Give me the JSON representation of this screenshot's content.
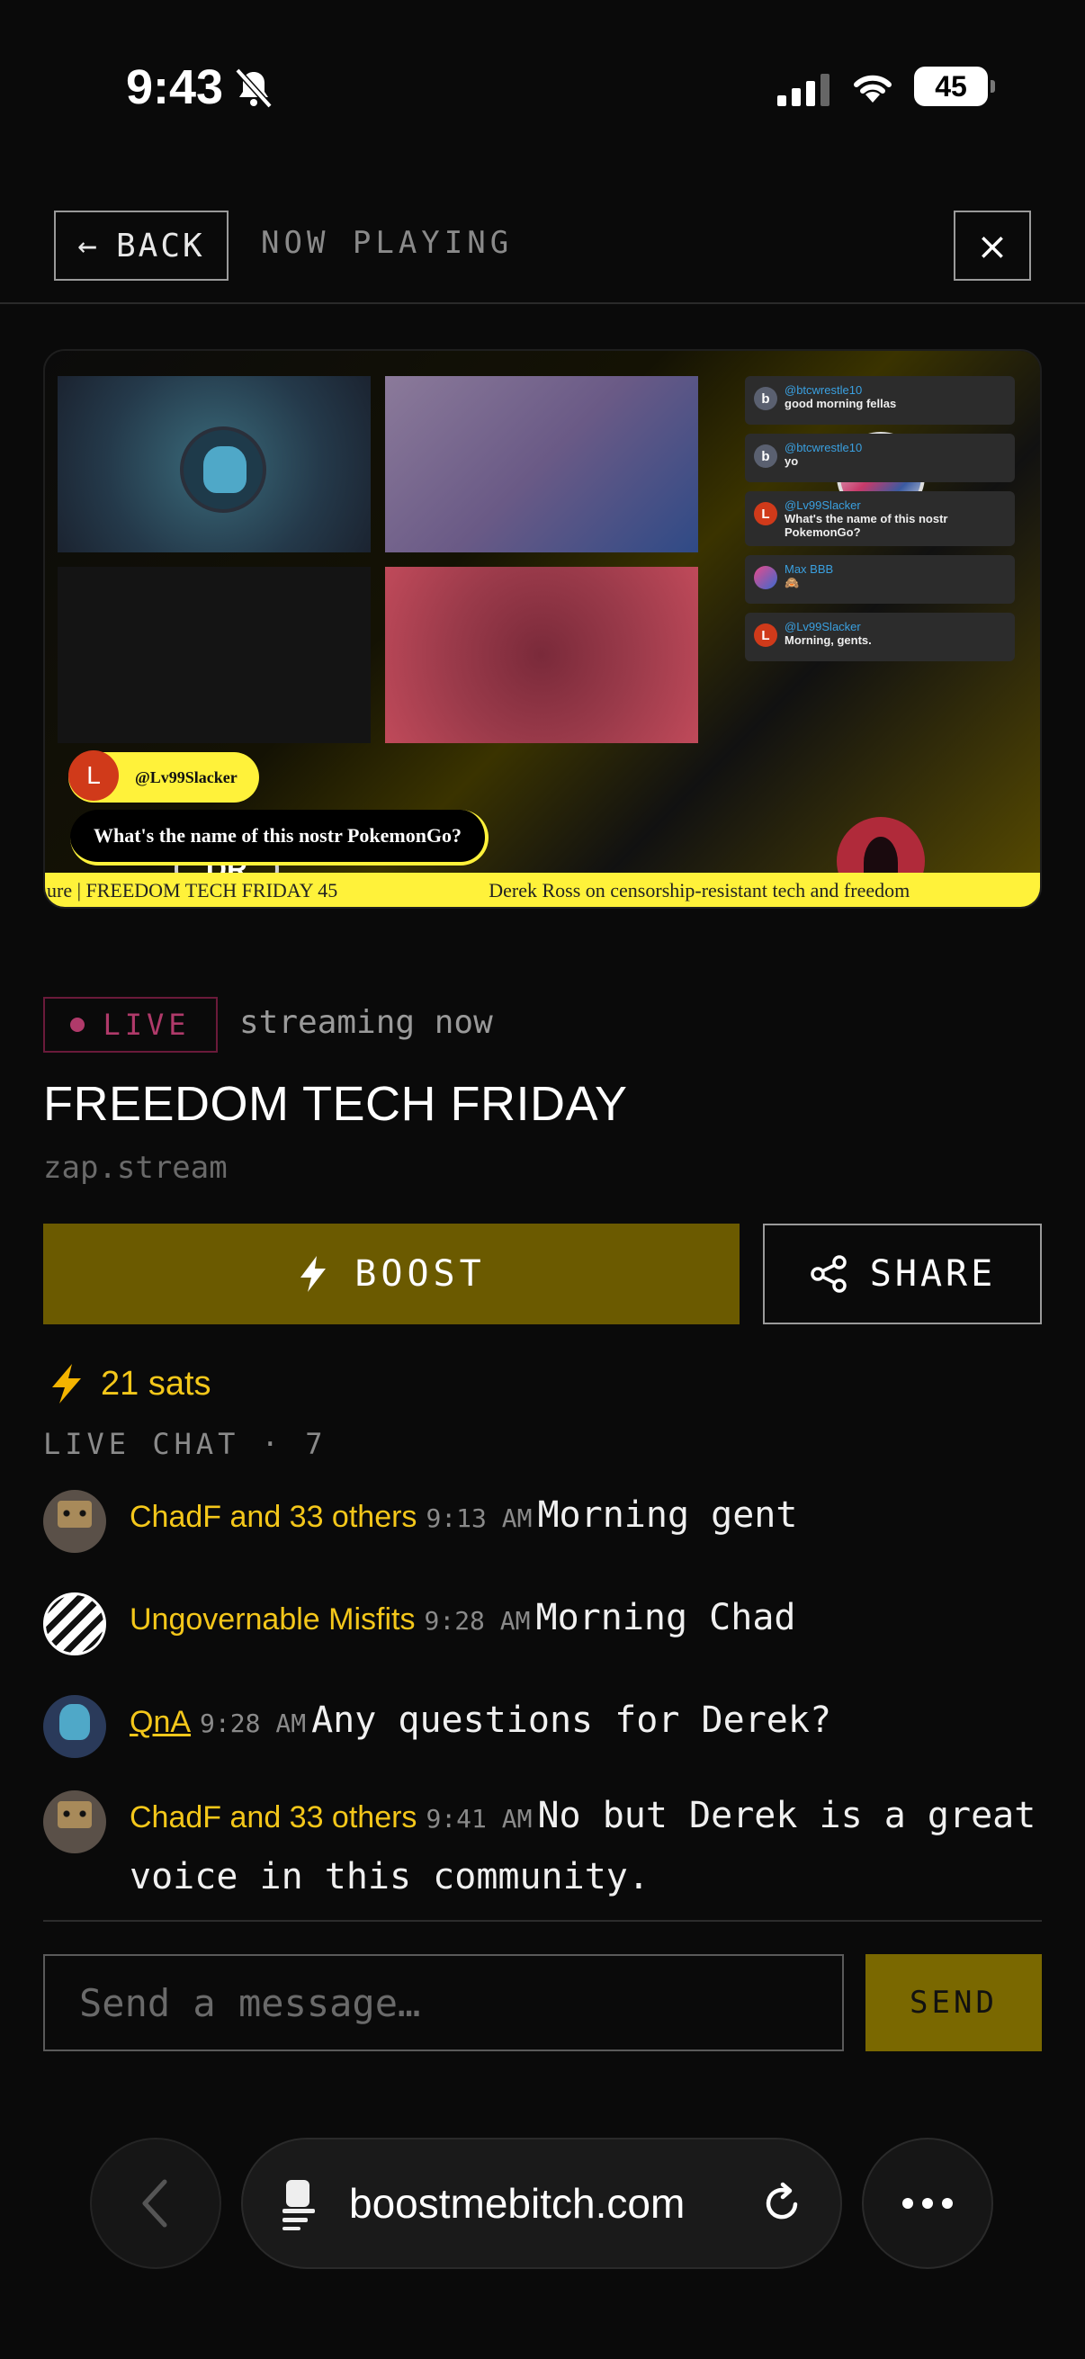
{
  "status_bar": {
    "time": "9:43",
    "battery": "45"
  },
  "header": {
    "back_label": "BACK",
    "now_playing": "NOW PLAYING",
    "close_label": "×"
  },
  "video": {
    "host_initials": "DR",
    "side_chat": [
      {
        "initial": "b",
        "user": "@btcwrestle10",
        "message": "good morning fellas"
      },
      {
        "initial": "b",
        "user": "@btcwrestle10",
        "message": "yo"
      },
      {
        "initial": "L",
        "user": "@Lv99Slacker",
        "message": "What's the name of this nostr PokemonGo?"
      },
      {
        "initial": "",
        "user": "Max BBB",
        "message": "🙈"
      },
      {
        "initial": "L",
        "user": "@Lv99Slacker",
        "message": "Morning, gents."
      }
    ],
    "featured_user_initial": "L",
    "featured_user": "@Lv99Slacker",
    "featured_question": "What's the name of this nostr PokemonGo?",
    "ticker_left": "ure | FREEDOM TECH FRIDAY 45",
    "ticker_right": "Derek Ross on censorship-resistant tech and freedom"
  },
  "stream": {
    "live_label": "LIVE",
    "status": "streaming now",
    "title": "FREEDOM TECH FRIDAY",
    "domain": "zap.stream"
  },
  "actions": {
    "boost_label": "BOOST",
    "share_label": "SHARE"
  },
  "sats": "21 sats",
  "chat": {
    "label": "LIVE CHAT · 7",
    "messages": [
      {
        "user": "ChadF and 33 others",
        "time": "9:13 AM",
        "text": "Morning gent"
      },
      {
        "user": "Ungovernable Misfits",
        "time": "9:28 AM",
        "text": "Morning Chad"
      },
      {
        "user": "QnA",
        "time": "9:28 AM",
        "text": "Any questions for Derek?"
      },
      {
        "user": "ChadF and 33 others",
        "time": "9:41 AM",
        "text": "No but Derek is a great voice in this community."
      }
    ],
    "input_placeholder": "Send a message…",
    "send_label": "SEND"
  },
  "browser": {
    "url": "boostmebitch.com"
  },
  "colors": {
    "accent_yellow": "#f4c71a",
    "boost_bg": "#6b5a00",
    "live": "#b03a6a"
  }
}
